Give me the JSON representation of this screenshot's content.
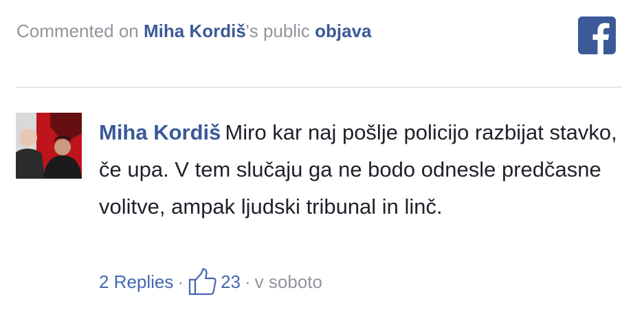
{
  "header": {
    "prefix": "Commented on ",
    "author": "Miha Kordiš",
    "middle": "'s public ",
    "post_link": "objava"
  },
  "brand": {
    "icon": "facebook-icon",
    "color": "#3b5998"
  },
  "comment": {
    "author": "Miha Kordiš",
    "text": "Miro kar naj pošlje policijo razbijat stavko, če upa. V tem slučaju ga ne bodo odnesle predčasne volitve, ampak ljudski tribunal in linč."
  },
  "footer": {
    "replies": "2 Replies",
    "separator": "·",
    "like_icon": "thumbs-up-icon",
    "likes": "23",
    "time": "v soboto"
  }
}
